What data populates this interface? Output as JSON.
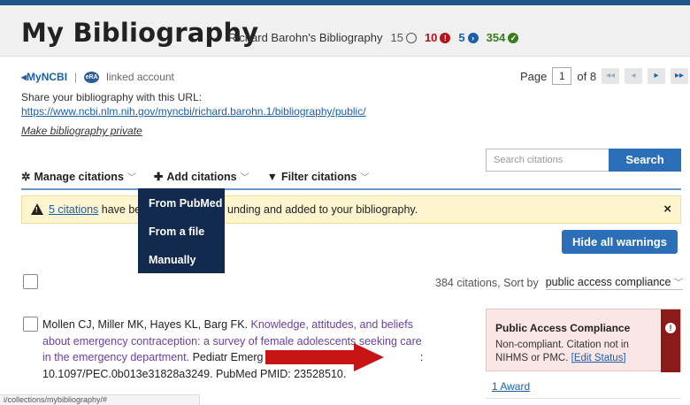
{
  "header": {
    "title": "My Bibliography",
    "owner": "Richard Barohn's Bibliography",
    "counts": [
      {
        "value": "15",
        "kind": "unchecked",
        "color": "#555555"
      },
      {
        "value": "10",
        "kind": "error",
        "color": "#b5121b"
      },
      {
        "value": "5",
        "kind": "in-progress",
        "color": "#1a5fa8"
      },
      {
        "value": "354",
        "kind": "compliant",
        "color": "#3a7d1c"
      }
    ]
  },
  "account": {
    "myncbi": "MyNCBI",
    "era_icon_text": "eRA",
    "linked": "linked account",
    "share_label": "Share your bibliography with this URL:",
    "share_url": "https://www.ncbi.nlm.nih.gov/myncbi/richard.barohn.1/bibliography/public/",
    "make_private": "Make bibliography private"
  },
  "pager": {
    "label": "Page",
    "current": "1",
    "of": "of 8"
  },
  "search": {
    "placeholder": "Search citations",
    "button": "Search"
  },
  "toolbar": {
    "manage": "Manage citations",
    "add": "Add citations",
    "filter": "Filter citations"
  },
  "add_menu": {
    "items": [
      "From PubMed",
      "From a file",
      "Manually"
    ]
  },
  "warning": {
    "link": "5 citations",
    "text_before": " have be",
    "text_after": "unding and added to your bibliography.",
    "close": "×",
    "hide_all": "Hide all warnings"
  },
  "sort": {
    "count_text": "384 citations, Sort by",
    "selected": "public access compliance"
  },
  "citation": {
    "authors": "Mollen CJ, Miller MK, Hayes KL, Barg FK.",
    "title": "Knowledge, attitudes, and beliefs about emergency contraception: a survey of female adolescents seeking care in the emergency department.",
    "journal_part": "Pediatr Emerg Care. 2",
    "journal_tail": ":",
    "doi_line": "10.1097/PEC.0b013e31828a3249. PubMed PMID: 23528510."
  },
  "compliance": {
    "heading": "Public Access Compliance",
    "body": "Non-compliant. Citation not in NIHMS or PMC.",
    "edit": "[Edit Status]",
    "award": "1 Award"
  },
  "status_url": "i/collections/mybibliography/#",
  "colors": {
    "brand_blue": "#2a6fb8",
    "menu_navy": "#122a4d",
    "warning_yellow": "#fff4d0",
    "noncompliant_red": "#8b1a1a",
    "annotation_arrow": "#c81414"
  }
}
